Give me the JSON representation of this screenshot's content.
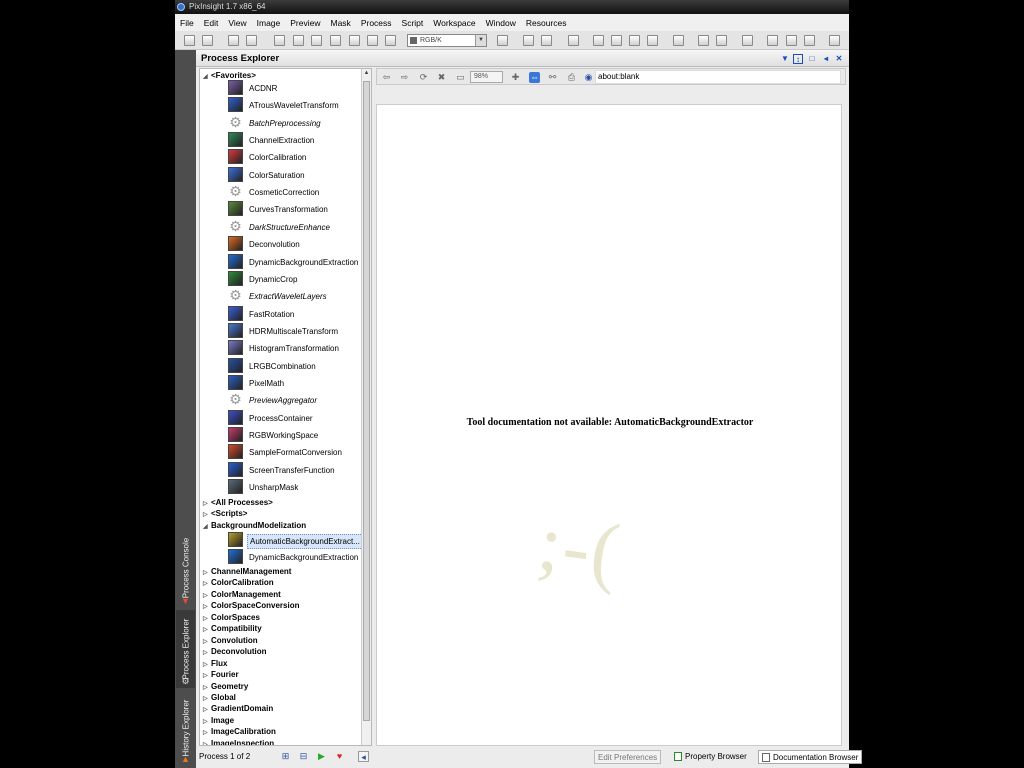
{
  "window": {
    "title": "PixInsight 1.7 x86_64"
  },
  "menu": [
    "File",
    "Edit",
    "View",
    "Image",
    "Preview",
    "Mask",
    "Process",
    "Script",
    "Workspace",
    "Window",
    "Resources"
  ],
  "toolbar": {
    "color_space": "RGB/K"
  },
  "side_tabs": [
    "Process Console",
    "Process Explorer",
    "History Explorer"
  ],
  "process_explorer": {
    "title": "Process Explorer",
    "favorites_label": "<Favorites>",
    "favorites": [
      {
        "label": "ACDNR",
        "icon": "acdnr-icon",
        "color": "#7a5fa8",
        "italic": false
      },
      {
        "label": "ATrousWaveletTransform",
        "icon": "wavelet-icon",
        "color": "#2d5fd1",
        "italic": false
      },
      {
        "label": "BatchPreprocessing",
        "icon": "gear-icon",
        "color": "#c8c8c8",
        "italic": true
      },
      {
        "label": "ChannelExtraction",
        "icon": "channel-extraction-icon",
        "color": "#2e8b57",
        "italic": false
      },
      {
        "label": "ColorCalibration",
        "icon": "color-calibration-icon",
        "color": "#d83a3a",
        "italic": false
      },
      {
        "label": "ColorSaturation",
        "icon": "color-saturation-icon",
        "color": "#3c6fe0",
        "italic": false
      },
      {
        "label": "CosmeticCorrection",
        "icon": "gear-icon",
        "color": "#c8c8c8",
        "italic": false
      },
      {
        "label": "CurvesTransformation",
        "icon": "curves-icon",
        "color": "#5a8a3a",
        "italic": false
      },
      {
        "label": "DarkStructureEnhance",
        "icon": "gear-icon",
        "color": "#c8c8c8",
        "italic": true
      },
      {
        "label": "Deconvolution",
        "icon": "deconvolution-icon",
        "color": "#e06a1f",
        "italic": false
      },
      {
        "label": "DynamicBackgroundExtraction",
        "icon": "dbe-icon",
        "color": "#1f6fd8",
        "italic": false
      },
      {
        "label": "DynamicCrop",
        "icon": "crop-icon",
        "color": "#2e8b3a",
        "italic": false
      },
      {
        "label": "ExtractWaveletLayers",
        "icon": "gear-icon",
        "color": "#c8c8c8",
        "italic": true
      },
      {
        "label": "FastRotation",
        "icon": "rotation-icon",
        "color": "#3a5fd8",
        "italic": false
      },
      {
        "label": "HDRMultiscaleTransform",
        "icon": "hdr-icon",
        "color": "#4a78d0",
        "italic": false
      },
      {
        "label": "HistogramTransformation",
        "icon": "histogram-icon",
        "color": "#7a7ac8",
        "italic": false
      },
      {
        "label": "LRGBCombination",
        "icon": "lrgb-icon",
        "color": "#2a4fa8",
        "italic": false
      },
      {
        "label": "PixelMath",
        "icon": "pixelmath-icon",
        "color": "#2b5fc8",
        "italic": false
      },
      {
        "label": "PreviewAggregator",
        "icon": "gear-icon",
        "color": "#c8c8c8",
        "italic": true
      },
      {
        "label": "ProcessContainer",
        "icon": "process-container-icon",
        "color": "#3a4fc8",
        "italic": false
      },
      {
        "label": "RGBWorkingSpace",
        "icon": "rgb-icon",
        "color": "#c83a6a",
        "italic": false
      },
      {
        "label": "SampleFormatConversion",
        "icon": "sample-format-icon",
        "color": "#d84a2a",
        "italic": false
      },
      {
        "label": "ScreenTransferFunction",
        "icon": "stf-icon",
        "color": "#2a5fd8",
        "italic": false
      },
      {
        "label": "UnsharpMask",
        "icon": "unsharp-mask-icon",
        "color": "#5a6a7a",
        "italic": false
      }
    ],
    "groups_top": [
      "<All Processes>",
      "<Scripts>"
    ],
    "expanded_category": "BackgroundModelization",
    "category_items": [
      {
        "label": "AutomaticBackgroundExtract...",
        "icon": "abe-icon",
        "color": "#b8a02a",
        "selected": true
      },
      {
        "label": "DynamicBackgroundExtraction",
        "icon": "dbe-icon",
        "color": "#1f6fd8",
        "selected": false
      }
    ],
    "categories": [
      "ChannelManagement",
      "ColorCalibration",
      "ColorManagement",
      "ColorSpaceConversion",
      "ColorSpaces",
      "Compatibility",
      "Convolution",
      "Deconvolution",
      "Flux",
      "Fourier",
      "Geometry",
      "Global",
      "GradientDomain",
      "Image",
      "ImageCalibration",
      "ImageInspection"
    ],
    "status": "Process 1 of 2"
  },
  "browser": {
    "zoom": "98%",
    "url": "about:blank",
    "message": "Tool documentation not available: AutomaticBackgroundExtractor",
    "sad_face": ";-("
  },
  "bottom_buttons": {
    "edit_preferences": "Edit Preferences",
    "property_browser": "Property Browser",
    "documentation_browser": "Documentation Browser"
  }
}
